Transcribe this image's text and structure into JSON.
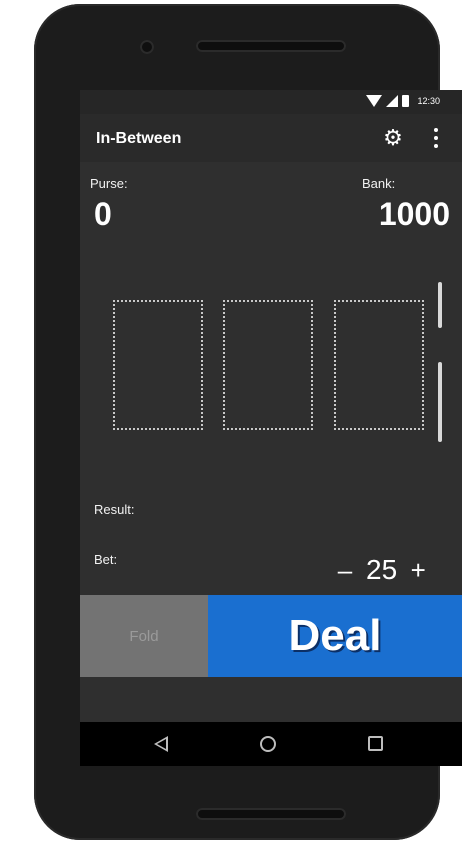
{
  "statusbar": {
    "time": "12:30"
  },
  "appbar": {
    "title": "In-Between",
    "settings_icon": "gear-icon",
    "menu_icon": "more-vert-icon"
  },
  "purse": {
    "label": "Purse:",
    "value": "0"
  },
  "bank": {
    "label": "Bank:",
    "value": "1000"
  },
  "cards": [
    {
      "state": "empty"
    },
    {
      "state": "empty"
    },
    {
      "state": "empty"
    }
  ],
  "result": {
    "label": "Result:",
    "value": ""
  },
  "bet": {
    "label": "Bet:",
    "minus": "–",
    "value": "25",
    "plus": "+"
  },
  "buttons": {
    "fold": "Fold",
    "deal": "Deal"
  },
  "colors": {
    "deal": "#1a6fd0",
    "fold": "#737373",
    "background": "#2f2f2f"
  },
  "navbar": {
    "icons": [
      "back-icon",
      "home-icon",
      "recents-icon"
    ]
  }
}
